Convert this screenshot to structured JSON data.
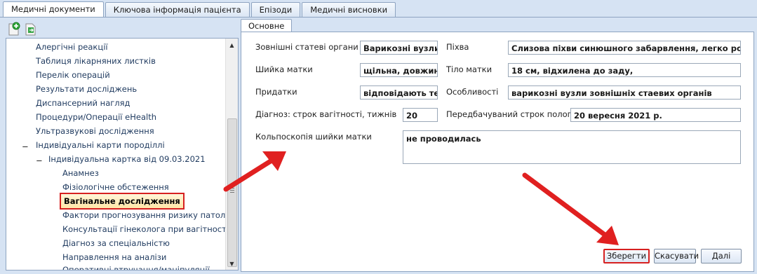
{
  "tabs": [
    {
      "label": "Медичні документи"
    },
    {
      "label": "Ключова інформація пацієнта"
    },
    {
      "label": "Епізоди"
    },
    {
      "label": "Медичні висновки"
    }
  ],
  "toolbar": {
    "add_icon": "add-document-icon",
    "export_icon": "export-document-icon"
  },
  "tree": {
    "items": [
      {
        "label": "Алергічні реакції"
      },
      {
        "label": "Таблиця лікарняних листків"
      },
      {
        "label": "Перелік операцій"
      },
      {
        "label": "Результати досліджень"
      },
      {
        "label": "Диспансерний нагляд"
      },
      {
        "label": "Процедури/Операції eHealth"
      },
      {
        "label": "Ультразвукові дослідження"
      },
      {
        "label": "Індивідуальні карти породіллі"
      },
      {
        "label": "Індивідуальна картка від 09.03.2021"
      },
      {
        "label": "Анамнез"
      },
      {
        "label": "Фізіологічне обстеження"
      },
      {
        "label": "Вагінальне дослідження"
      },
      {
        "label": "Фактори прогнозування ризику патології"
      },
      {
        "label": "Консультації гінеколога при вагітності"
      },
      {
        "label": "Діагноз за спеціальністю"
      },
      {
        "label": "Направлення на аналізи"
      },
      {
        "label": "Оперативні втручання/маніпуляції"
      }
    ],
    "expand_glyph": "⊟"
  },
  "subtab": {
    "label": "Основне"
  },
  "form": {
    "external_organs_label": "Зовнішні статеві органи",
    "external_organs_value": "Варикозні вузли",
    "vagina_label": "Піхва",
    "vagina_value": "Слизова піхви  синюшного забарвлення, легко розтяжна",
    "cervix_label": "Шийка матки",
    "cervix_value": "щільна, довжина",
    "uterus_body_label": "Тіло матки",
    "uterus_body_value": "18 см, відхилена до заду,",
    "adnexa_label": "Придатки",
    "adnexa_value": "відповідають тер",
    "features_label": "Особливості",
    "features_value": "варикозні вузли зовнішніх стаевих органів",
    "gest_age_label": "Діагноз: строк вагітності, тижнів",
    "gest_age_value": "20",
    "due_date_label": "Передбачуваний строк пологів",
    "due_date_value": "20 вересня 2021 р.",
    "colposcopy_label": "Кольпоскопія шийки матки",
    "colposcopy_value": "не проводилась"
  },
  "buttons": {
    "save": "Зберегти",
    "cancel": "Скасувати",
    "next": "Далі"
  },
  "annotation_color": "#e02020"
}
